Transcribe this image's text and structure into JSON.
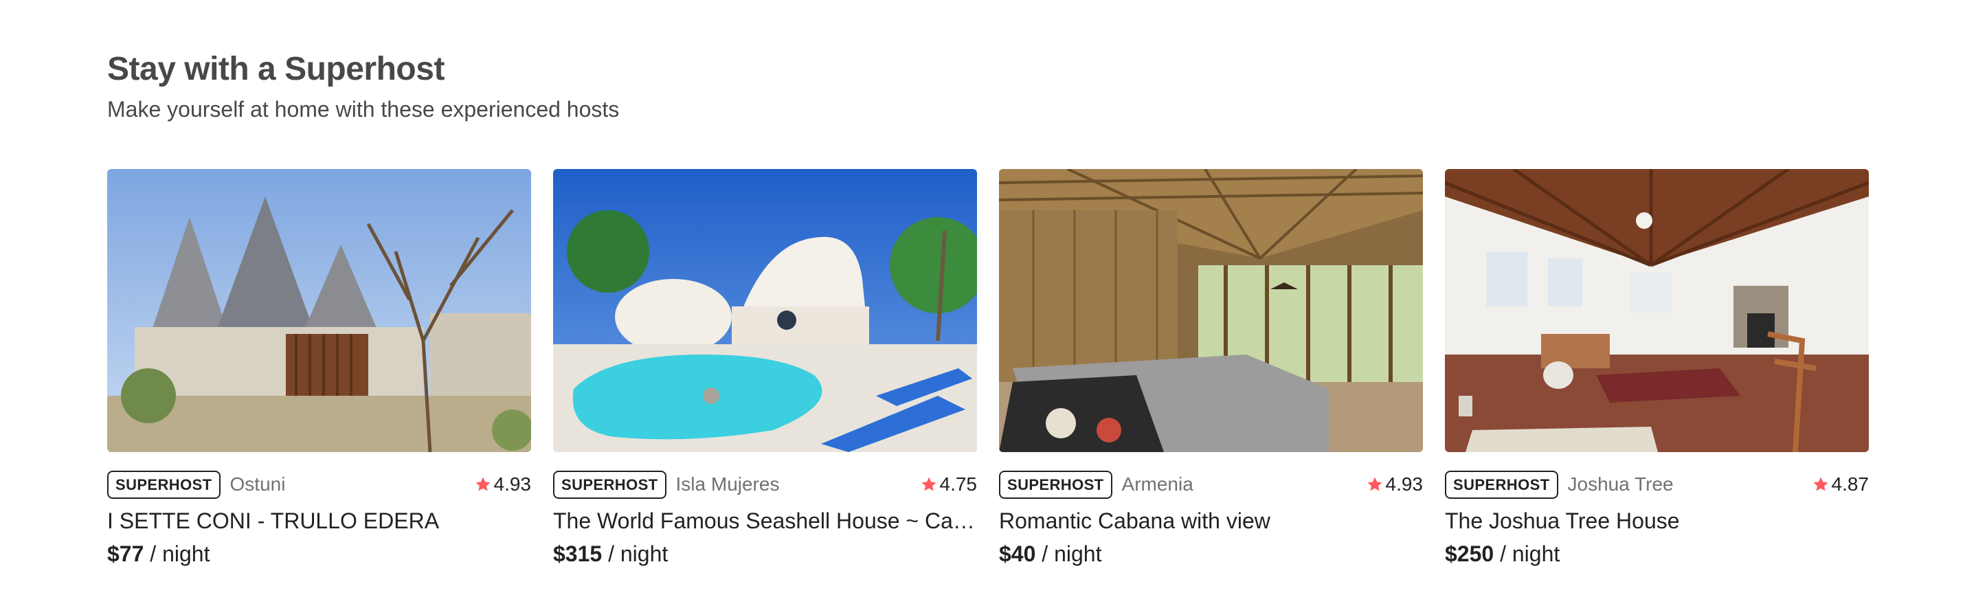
{
  "section": {
    "title": "Stay with a Superhost",
    "subtitle": "Make yourself at home with these experienced hosts"
  },
  "colors": {
    "star": "#ff5a5f",
    "text": "#222222",
    "muted": "#717171",
    "heading": "#484848"
  },
  "icons": {
    "rating": "star-icon"
  },
  "listings": [
    {
      "badge": "SUPERHOST",
      "location": "Ostuni",
      "rating": "4.93",
      "name": "I SETTE CONI - TRULLO EDERA",
      "price": "$77",
      "per": "/ night",
      "photo_desc": "trullo-stone-houses-gate"
    },
    {
      "badge": "SUPERHOST",
      "location": "Isla Mujeres",
      "rating": "4.75",
      "name": "The World Famous Seashell House ~ Casa Caracol",
      "price": "$315",
      "per": "/ night",
      "photo_desc": "seashell-house-pool"
    },
    {
      "badge": "SUPERHOST",
      "location": "Armenia",
      "rating": "4.93",
      "name": "Romantic Cabana with view",
      "price": "$40",
      "per": "/ night",
      "photo_desc": "bamboo-cabana-bedroom"
    },
    {
      "badge": "SUPERHOST",
      "location": "Joshua Tree",
      "rating": "4.87",
      "name": "The Joshua Tree House",
      "price": "$250",
      "per": "/ night",
      "photo_desc": "wooden-ceiling-living-room"
    }
  ]
}
